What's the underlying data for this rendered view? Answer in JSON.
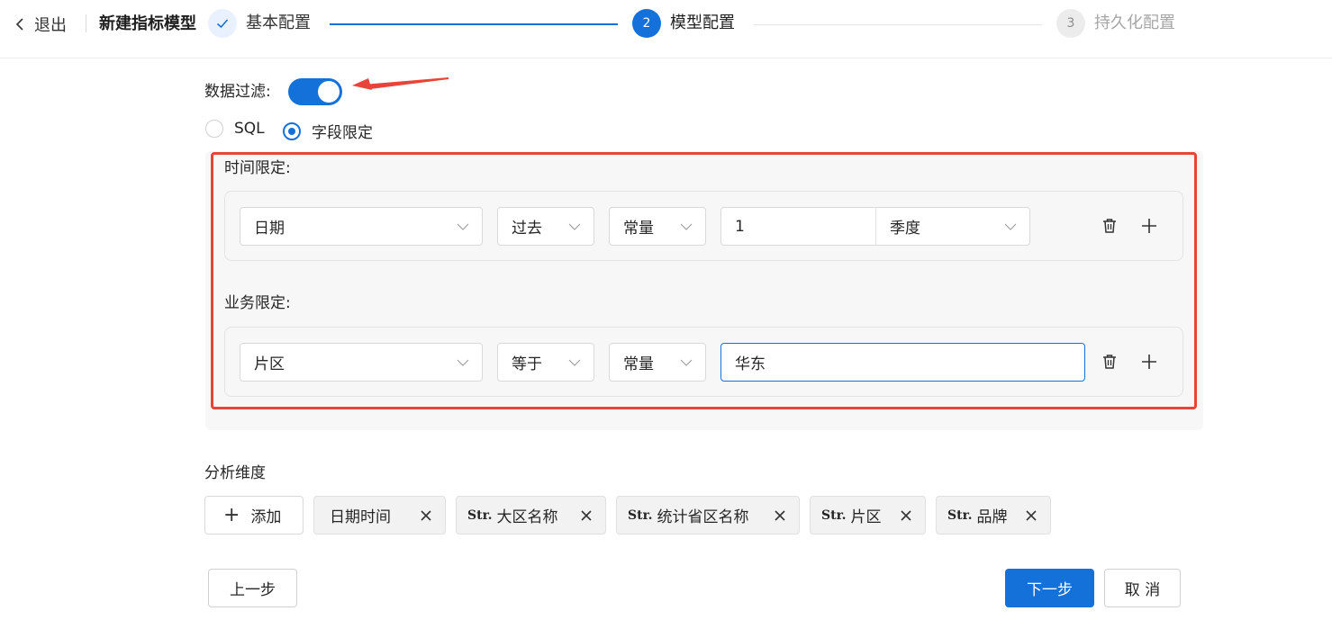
{
  "header": {
    "back_label": "退出",
    "title": "新建指标模型",
    "steps": [
      {
        "number": "1",
        "label": "基本配置",
        "status": "done"
      },
      {
        "number": "2",
        "label": "模型配置",
        "status": "active"
      },
      {
        "number": "3",
        "label": "持久化配置",
        "status": "pending"
      }
    ]
  },
  "filter": {
    "label": "数据过滤:",
    "enabled": true,
    "modes": [
      {
        "label": "SQL",
        "checked": false
      },
      {
        "label": "字段限定",
        "checked": true
      }
    ]
  },
  "time_limit": {
    "label": "时间限定:",
    "field": "日期",
    "operator": "过去",
    "value_type": "常量",
    "amount": "1",
    "unit": "季度"
  },
  "business_limit": {
    "label": "业务限定:",
    "field": "片区",
    "operator": "等于",
    "value_type": "常量",
    "value": "华东"
  },
  "dimensions": {
    "label": "分析维度",
    "add_label": "添加",
    "type_prefix": "Str.",
    "items": [
      {
        "label": "日期时间",
        "is_str": false
      },
      {
        "label": "大区名称",
        "is_str": true
      },
      {
        "label": "统计省区名称",
        "is_str": true
      },
      {
        "label": "片区",
        "is_str": true
      },
      {
        "label": "品牌",
        "is_str": true
      }
    ]
  },
  "footer": {
    "prev_label": "上一步",
    "next_label": "下一步",
    "cancel_label": "取 消"
  },
  "colors": {
    "primary": "#1571da",
    "annotation_red": "#e8443a"
  }
}
